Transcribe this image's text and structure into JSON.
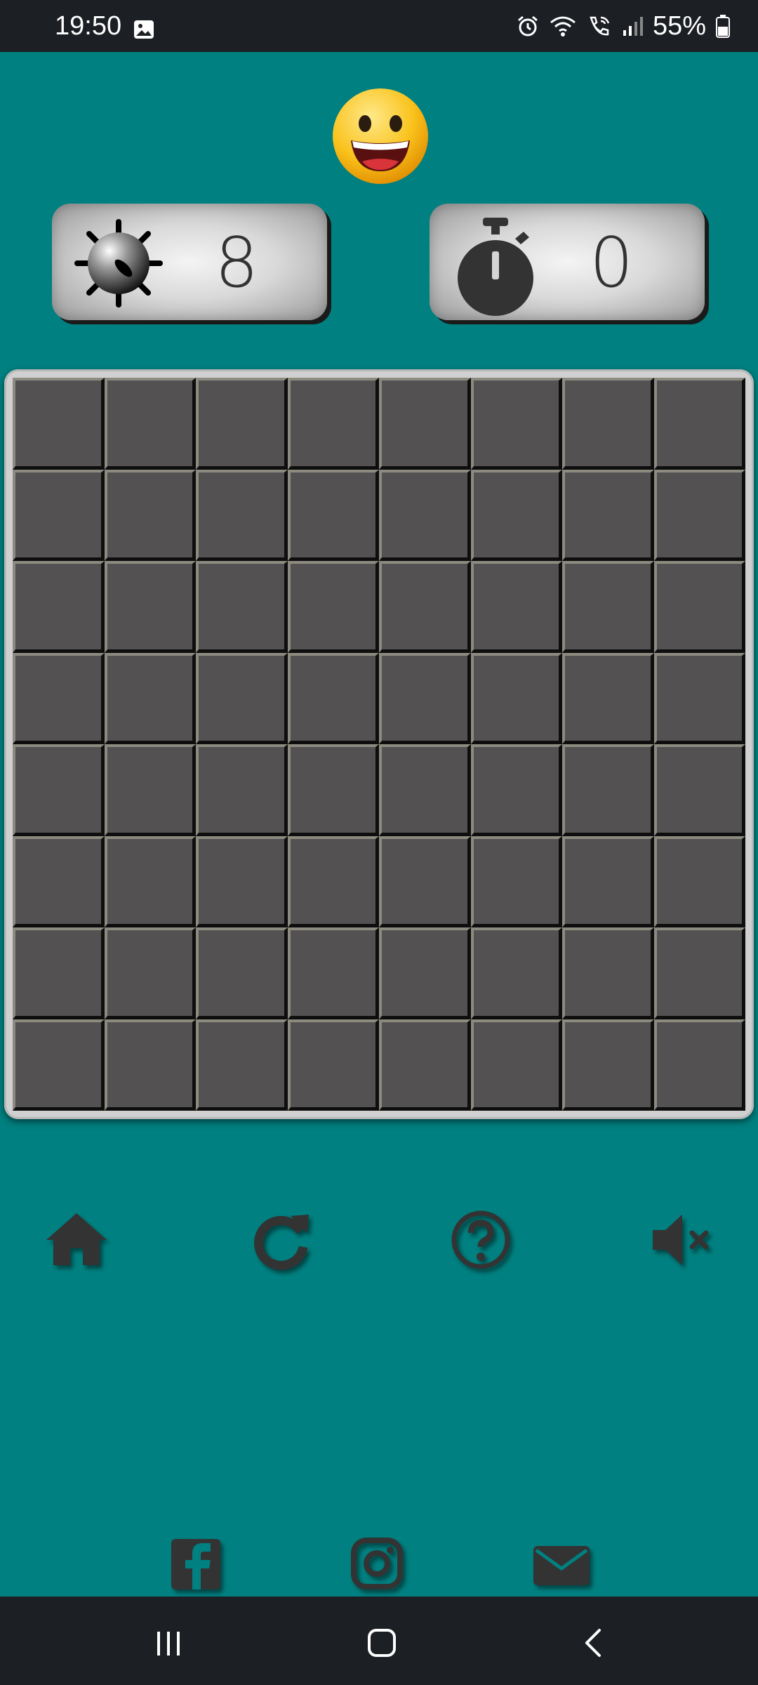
{
  "status_bar": {
    "time": "19:50",
    "battery": "55%",
    "icons": [
      "gallery-icon",
      "alarm-icon",
      "wifi-icon",
      "wifi-calling-icon",
      "signal-icon",
      "battery-icon"
    ]
  },
  "game": {
    "face": "smiley-face",
    "mines_remaining": "8",
    "timer": "0",
    "board": {
      "rows": 8,
      "columns": 8,
      "state": "all cells unrevealed"
    }
  },
  "controls": {
    "items": [
      "home-icon",
      "restart-icon",
      "help-icon",
      "sound-muted-icon"
    ]
  },
  "social": {
    "items": [
      "facebook-icon",
      "instagram-icon",
      "email-icon"
    ]
  },
  "nav_bar": {
    "items": [
      "recent-apps-icon",
      "home-nav-icon",
      "back-icon"
    ]
  },
  "colors": {
    "background": "#008080",
    "cell": "#535151",
    "bars": "#1c1f24",
    "icon": "#333333"
  }
}
